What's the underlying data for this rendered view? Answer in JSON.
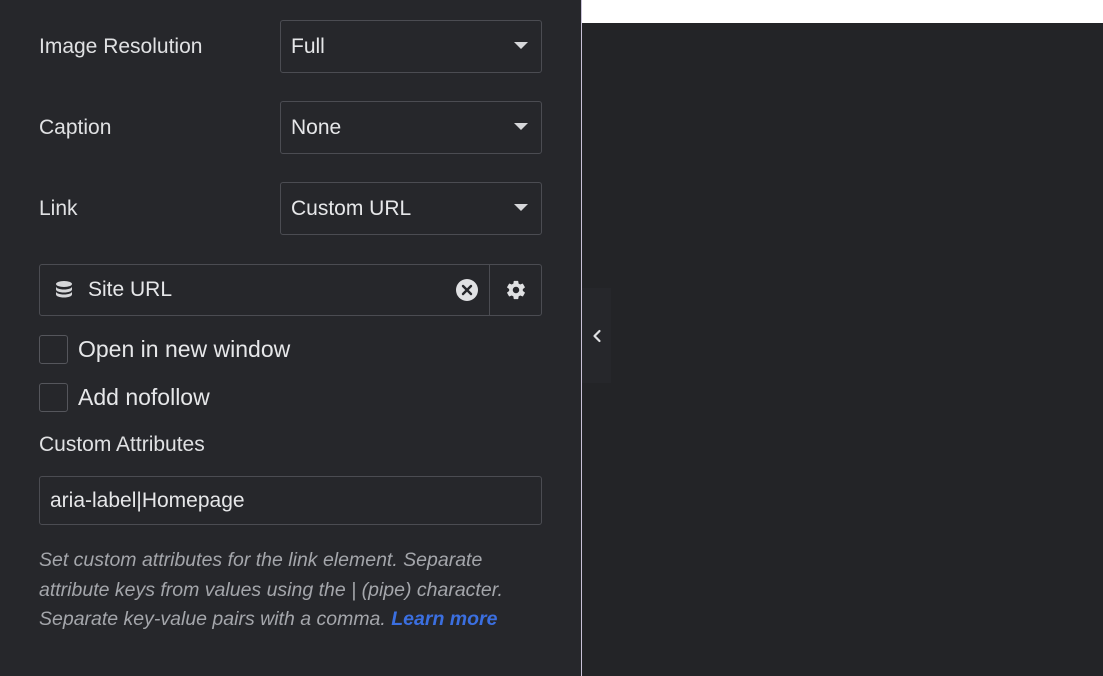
{
  "settings": {
    "image_resolution": {
      "label": "Image Resolution",
      "value": "Full"
    },
    "caption": {
      "label": "Caption",
      "value": "None"
    },
    "link": {
      "label": "Link",
      "value": "Custom URL"
    },
    "dynamic_tag": {
      "label": "Site URL",
      "icon": "database-icon"
    },
    "open_new_window": {
      "label": "Open in new window",
      "checked": false
    },
    "add_nofollow": {
      "label": "Add nofollow",
      "checked": false
    },
    "custom_attributes": {
      "label": "Custom Attributes",
      "value": "aria-label|Homepage",
      "help_text": "Set custom attributes for the link element. Separate attribute keys from values using the | (pipe) character. Separate key-value pairs with a comma.",
      "learn_more": "Learn more"
    }
  },
  "colors": {
    "panel_bg": "#26272b",
    "preview_bg": "#232427",
    "accent_link": "#3b6fe0",
    "border": "#4b4c52"
  }
}
